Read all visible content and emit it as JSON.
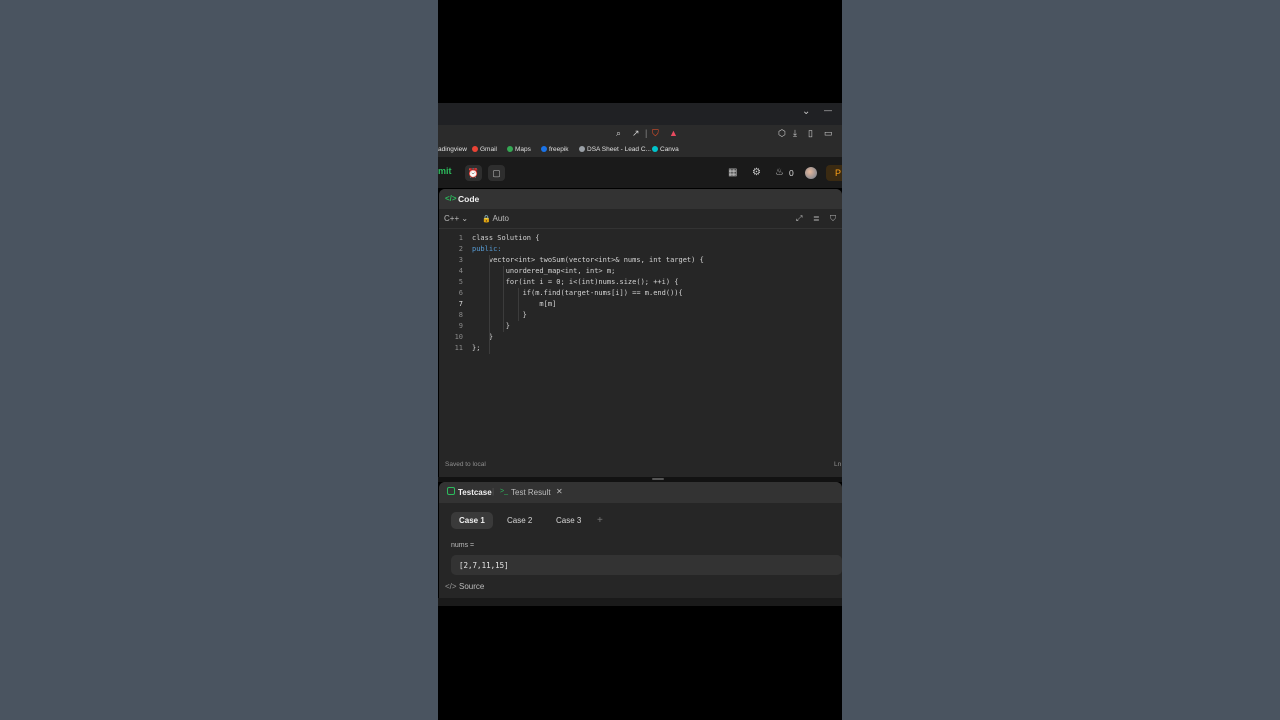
{
  "window": {
    "chevron": "⌄",
    "minimize": "—"
  },
  "bookmarks": [
    {
      "label": "adingview",
      "color": "#8a8a8a"
    },
    {
      "label": "Gmail",
      "color": "#ea4335"
    },
    {
      "label": "Maps",
      "color": "#34a853"
    },
    {
      "label": "freepik",
      "color": "#1a73e8"
    },
    {
      "label": "DSA Sheet - Lead C...",
      "color": "#9aa0a6"
    },
    {
      "label": "Canva",
      "color": "#00c4cc"
    }
  ],
  "topbar": {
    "submit_label": "mit",
    "streak_count": "0",
    "premium_label": "P"
  },
  "code_panel": {
    "title": "Code",
    "language": "C++",
    "mode": "Auto",
    "saved_status": "Saved to local",
    "cursor_status": "Ln",
    "lines": [
      {
        "n": "1",
        "text": "class Solution {"
      },
      {
        "n": "2",
        "text": "public:"
      },
      {
        "n": "3",
        "text": "    vector<int> twoSum(vector<int>& nums, int target) {"
      },
      {
        "n": "4",
        "text": "        unordered_map<int, int> m;"
      },
      {
        "n": "5",
        "text": "        for(int i = 0; i<(int)nums.size(); ++i) {"
      },
      {
        "n": "6",
        "text": "            if(m.find(target-nums[i]) == m.end()){"
      },
      {
        "n": "7",
        "text": "                m[m]"
      },
      {
        "n": "8",
        "text": "            }"
      },
      {
        "n": "9",
        "text": "        }"
      },
      {
        "n": "10",
        "text": "    }"
      },
      {
        "n": "11",
        "text": "};"
      }
    ]
  },
  "testcase_panel": {
    "tab_testcase": "Testcase",
    "tab_result": "Test Result",
    "cases": [
      "Case 1",
      "Case 2",
      "Case 3"
    ],
    "add_case": "+",
    "input_label": "nums =",
    "input_value": "[2,7,11,15]",
    "source_label": "Source"
  },
  "colors": {
    "accent_green": "#2cbb5d",
    "accent_orange": "#ffa116"
  }
}
